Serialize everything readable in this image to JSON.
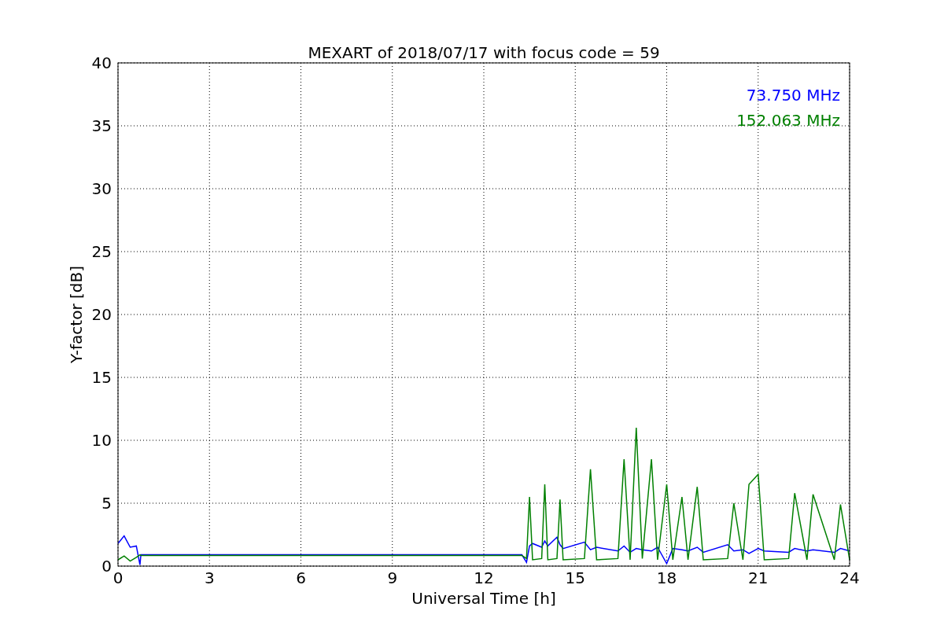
{
  "figure": {
    "chart_data": {
      "type": "line",
      "title": "MEXART of 2018/07/17 with focus code = 59",
      "xlabel": "Universal Time [h]",
      "ylabel": "Y-factor [dB]",
      "x": [
        0,
        0.2,
        0.4,
        0.6,
        0.72,
        0.75,
        13.25,
        13.4,
        13.5,
        13.6,
        13.9,
        14,
        14.1,
        14.4,
        14.5,
        14.6,
        15.3,
        15.5,
        15.7,
        16.4,
        16.6,
        16.8,
        17,
        17.2,
        17.5,
        17.7,
        18,
        18.2,
        18.5,
        18.7,
        19,
        19.2,
        20,
        20.2,
        20.5,
        20.7,
        21,
        21.2,
        22,
        22.2,
        22.6,
        22.8,
        23.5,
        23.7,
        24
      ],
      "series": [
        {
          "name": "73.750 MHz",
          "color": "#0000ff",
          "values": [
            1.8,
            2.4,
            1.5,
            1.6,
            0.1,
            0.9,
            0.9,
            0.3,
            1.6,
            1.8,
            1.5,
            2.0,
            1.6,
            2.3,
            1.7,
            1.4,
            1.9,
            1.3,
            1.5,
            1.2,
            1.6,
            1.1,
            1.4,
            1.3,
            1.2,
            1.5,
            0.2,
            1.4,
            1.3,
            1.2,
            1.5,
            1.1,
            1.7,
            1.2,
            1.3,
            1.0,
            1.4,
            1.2,
            1.1,
            1.4,
            1.2,
            1.3,
            1.1,
            1.4,
            1.2
          ]
        },
        {
          "name": "152.063 MHz",
          "color": "#008000",
          "values": [
            0.5,
            0.8,
            0.4,
            0.7,
            0.9,
            0.85,
            0.85,
            0.6,
            5.5,
            0.5,
            0.6,
            6.5,
            0.5,
            0.6,
            5.3,
            0.5,
            0.6,
            7.7,
            0.5,
            0.6,
            8.5,
            0.5,
            11,
            0.6,
            8.5,
            0.5,
            6.5,
            0.5,
            5.5,
            0.5,
            6.3,
            0.5,
            0.6,
            5,
            0.5,
            6.5,
            7.3,
            0.5,
            0.6,
            5.8,
            0.5,
            5.7,
            0.5,
            4.9,
            0.5
          ]
        }
      ],
      "grid": true,
      "xlim": [
        0,
        24
      ],
      "ylim": [
        0,
        40
      ],
      "xticks": [
        0,
        3,
        6,
        9,
        12,
        15,
        18,
        21,
        24
      ],
      "yticks": [
        0,
        5,
        10,
        15,
        20,
        25,
        30,
        35,
        40
      ]
    }
  }
}
